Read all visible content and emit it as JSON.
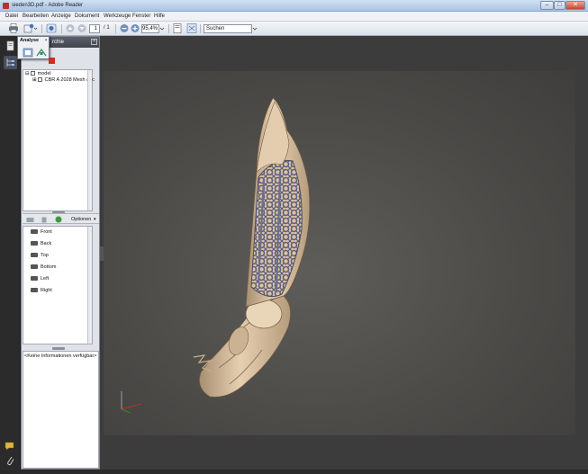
{
  "window": {
    "title": "sieden3D.pdf - Adobe Reader"
  },
  "menu": [
    "Datei",
    "Bearbeiten",
    "Anzeige",
    "Dokument",
    "Werkzeuge",
    "Fenster",
    "Hilfe"
  ],
  "toolbar": {
    "page_current": "1",
    "page_total": "/ 1",
    "zoom": "95,4%",
    "search_placeholder": "Suchen"
  },
  "analysis_popup": {
    "label": "Analyse",
    "dot": "•"
  },
  "model_tree": {
    "header_title": "rchie",
    "items": [
      {
        "label": "model"
      },
      {
        "label": "CBR A 2028 Mesh anc"
      }
    ]
  },
  "views": {
    "options_label": "Optionen",
    "items": [
      "Front",
      "Back",
      "Top",
      "Bottom",
      "Left",
      "Right"
    ]
  },
  "info": {
    "text": "<Keine Informationen verfügbar>"
  },
  "colors": {
    "bone": "#dcc3a2",
    "mesh": "#5d607c",
    "viewport": "#4a4946"
  }
}
